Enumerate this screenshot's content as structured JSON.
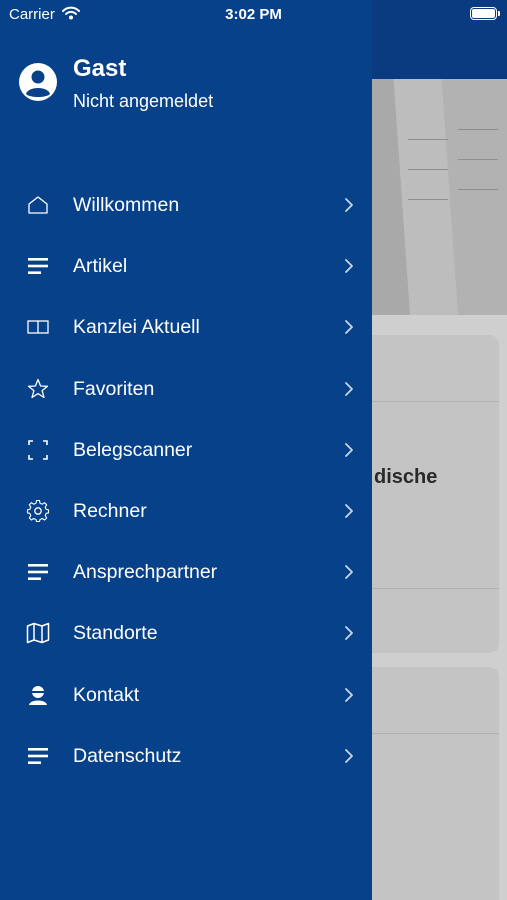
{
  "status_bar": {
    "carrier": "Carrier",
    "time": "3:02 PM"
  },
  "drawer": {
    "background_color": "#07418a",
    "user": {
      "name": "Gast",
      "status": "Nicht angemeldet"
    },
    "menu_items": [
      {
        "label": "Willkommen",
        "icon": "home-icon"
      },
      {
        "label": "Artikel",
        "icon": "list-icon"
      },
      {
        "label": "Kanzlei Aktuell",
        "icon": "book-icon"
      },
      {
        "label": "Favoriten",
        "icon": "star-icon"
      },
      {
        "label": "Belegscanner",
        "icon": "scan-icon"
      },
      {
        "label": "Rechner",
        "icon": "gear-icon"
      },
      {
        "label": "Ansprechpartner",
        "icon": "list-icon"
      },
      {
        "label": "Standorte",
        "icon": "map-icon"
      },
      {
        "label": "Kontakt",
        "icon": "contact-icon"
      },
      {
        "label": "Datenschutz",
        "icon": "list-icon"
      }
    ]
  },
  "background": {
    "card_text_fragment": "dische"
  }
}
